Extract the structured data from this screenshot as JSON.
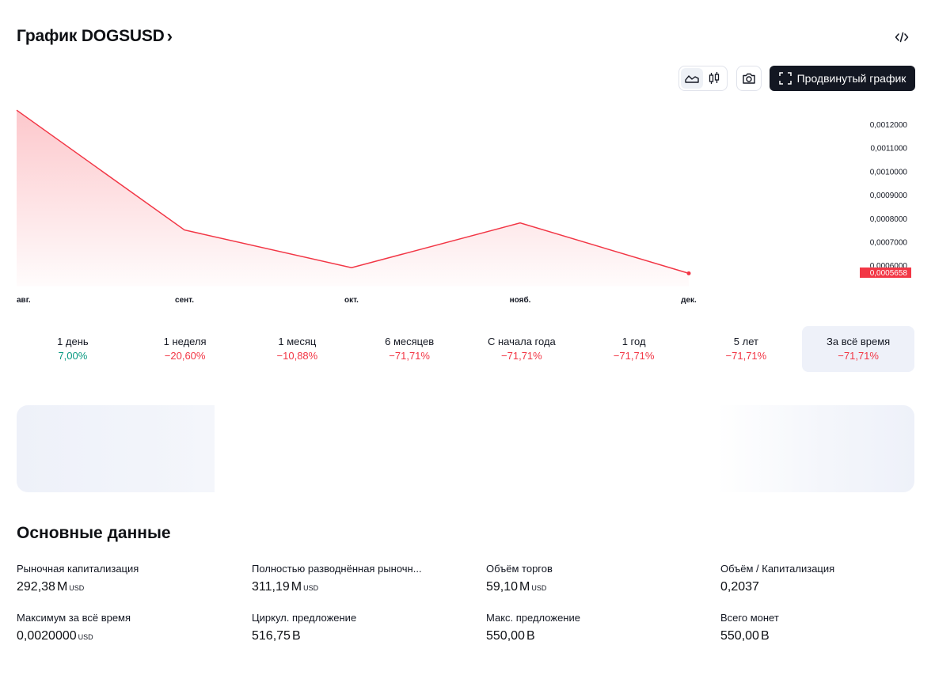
{
  "header": {
    "title": "График DOGSUSD",
    "chevron": "›",
    "embed_icon": "code-icon"
  },
  "toolbar": {
    "area_icon": "area-chart-icon",
    "candles_icon": "candlestick-icon",
    "camera_icon": "camera-icon",
    "advanced_label": "Продвинутый график",
    "advanced_icon": "fullscreen-icon"
  },
  "chart_data": {
    "type": "area",
    "x": [
      "авг.",
      "сент.",
      "окт.",
      "нояб.",
      "дек."
    ],
    "values": [
      0.00126,
      0.00075,
      0.00059,
      0.00078,
      0.0005658
    ],
    "y_ticks": [
      "0,0012000",
      "0,0011000",
      "0,0010000",
      "0,0009000",
      "0,0008000",
      "0,0007000",
      "0,0006000"
    ],
    "last_value_label": "0,0005658",
    "line_color": "#f23645",
    "fill_color": "#f7525f"
  },
  "periods": [
    {
      "label": "1 день",
      "value": "7,00%",
      "trend": "up"
    },
    {
      "label": "1 неделя",
      "value": "−20,60%",
      "trend": "down"
    },
    {
      "label": "1 месяц",
      "value": "−10,88%",
      "trend": "down"
    },
    {
      "label": "6 месяцев",
      "value": "−71,71%",
      "trend": "down"
    },
    {
      "label": "С начала года",
      "value": "−71,71%",
      "trend": "down"
    },
    {
      "label": "1 год",
      "value": "−71,71%",
      "trend": "down"
    },
    {
      "label": "5 лет",
      "value": "−71,71%",
      "trend": "down"
    },
    {
      "label": "За всё время",
      "value": "−71,71%",
      "trend": "down",
      "active": true
    }
  ],
  "key_data": {
    "title": "Основные данные",
    "stats": [
      {
        "label": "Рыночная капитализация",
        "value": "292,38",
        "suffix": "M",
        "unit": "USD"
      },
      {
        "label": "Полностью разводнённая рыночн...",
        "value": "311,19",
        "suffix": "M",
        "unit": "USD"
      },
      {
        "label": "Объём торгов",
        "value": "59,10",
        "suffix": "M",
        "unit": "USD"
      },
      {
        "label": "Объём / Капитализация",
        "value": "0,2037",
        "suffix": "",
        "unit": ""
      },
      {
        "label": "Максимум за всё время",
        "value": "0,0020000",
        "suffix": "",
        "unit": "USD"
      },
      {
        "label": "Циркул. предложение",
        "value": "516,75",
        "suffix": "B",
        "unit": ""
      },
      {
        "label": "Макс. предложение",
        "value": "550,00",
        "suffix": "B",
        "unit": ""
      },
      {
        "label": "Всего монет",
        "value": "550,00",
        "suffix": "B",
        "unit": ""
      }
    ]
  }
}
